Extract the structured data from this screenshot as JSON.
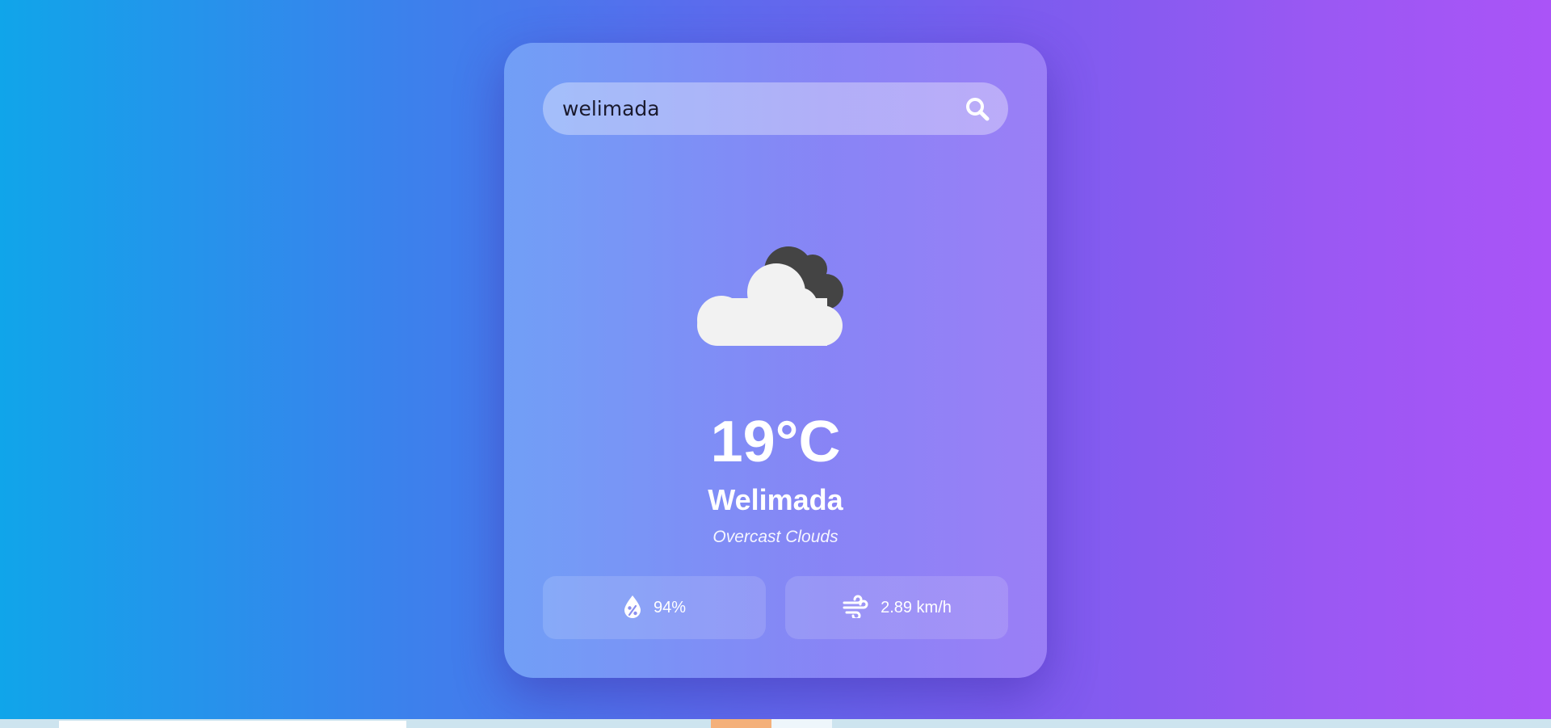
{
  "search": {
    "value": "welimada",
    "icon": "search-icon"
  },
  "weather": {
    "icon": "overcast-clouds-icon",
    "temperature": "19°C",
    "city": "Welimada",
    "description": "Overcast Clouds"
  },
  "stats": {
    "humidity": {
      "icon": "humidity-icon",
      "value": "94%"
    },
    "wind": {
      "icon": "wind-icon",
      "value": "2.89 km/h"
    }
  },
  "colors": {
    "background_start": "#10a5ea",
    "background_end": "#aa54f7",
    "text": "#ffffff"
  }
}
